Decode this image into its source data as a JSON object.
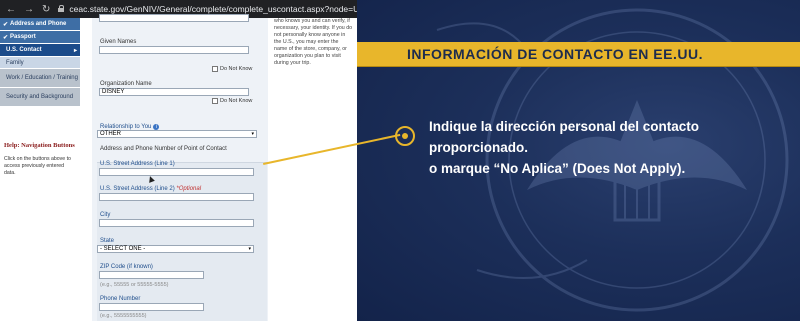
{
  "browser": {
    "url": "ceac.state.gov/GenNIV/General/complete/complete_uscontact.aspx?node=USContact"
  },
  "leftnav": {
    "items": [
      {
        "label": "Address and Phone"
      },
      {
        "label": "Passport"
      },
      {
        "label": "U.S. Contact"
      },
      {
        "label": "Family"
      },
      {
        "label": "Work / Education / Training"
      },
      {
        "label": "Security and Background"
      }
    ],
    "help_title": "Help: Navigation Buttons",
    "help_text": "Click on the buttons above to access previously entered data."
  },
  "form": {
    "given_names_label": "Given Names",
    "do_not_know_1": "Do Not Know",
    "org_name_label": "Organization Name",
    "org_name_value": "DISNEY",
    "do_not_know_2": "Do Not Know",
    "relationship_label": "Relationship to You",
    "relationship_value": "OTHER",
    "address_section_label": "Address and Phone Number of Point of Contact",
    "street1_label": "U.S. Street Address (Line 1)",
    "street2_label": "U.S. Street Address (Line 2)",
    "optional_tag": "*Optional",
    "city_label": "City",
    "state_label": "State",
    "state_value": "- SELECT ONE -",
    "zip_label": "ZIP Code (if known)",
    "zip_hint": "(e.g., 55555 or 55555-5555)",
    "phone_label": "Phone Number",
    "phone_hint": "(e.g., 5555555555)"
  },
  "help_side": {
    "text": "who knows you and can verify, if necessary, your identity. If you do not personally know anyone in the U.S., you may enter the name of the store, company, or organization you plan to visit during your trip."
  },
  "overlay": {
    "banner_title": "INFORMACIÓN DE CONTACTO EN EE.UU.",
    "caption_line1": "Indique la dirección personal del contacto proporcionado.",
    "caption_line2": "o marque “No Aplica” (Does Not Apply).",
    "accent_color": "#e8b62b"
  }
}
